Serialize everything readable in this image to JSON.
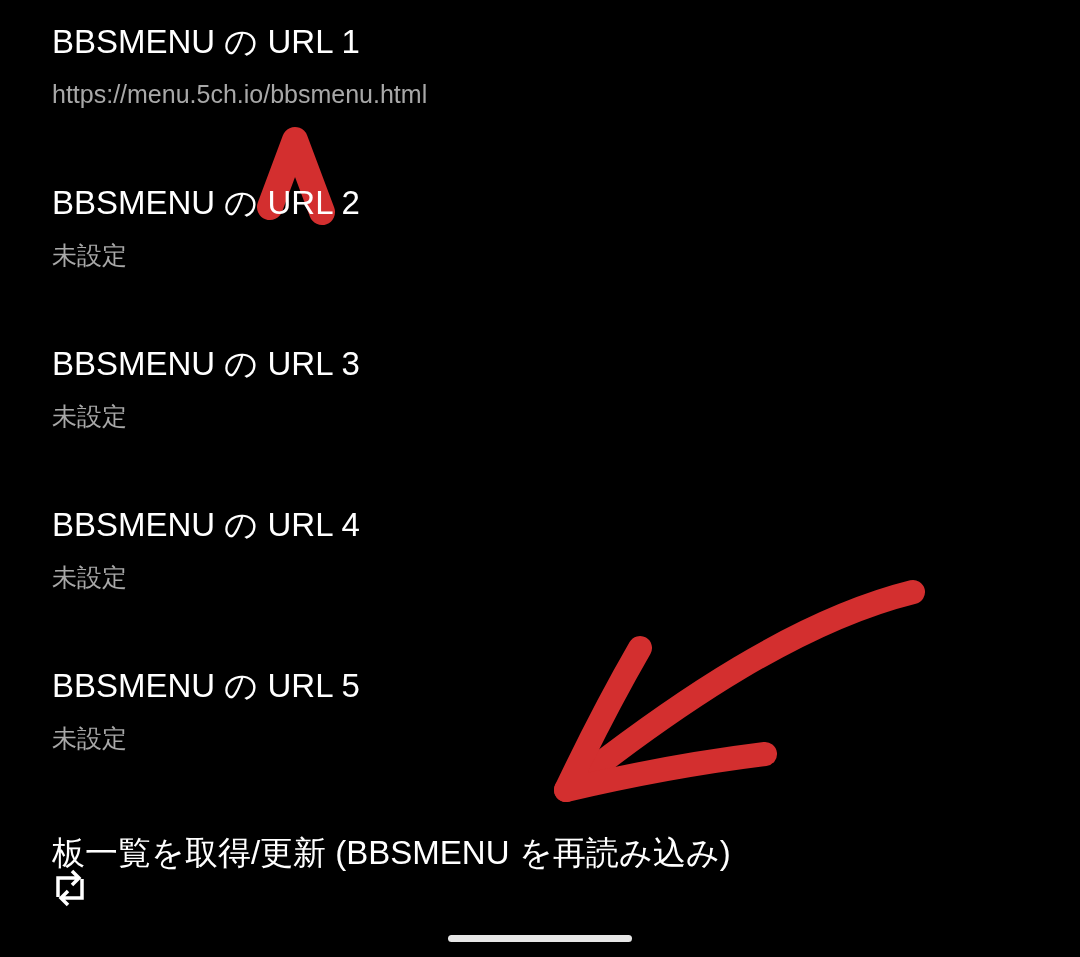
{
  "settings": [
    {
      "kind": "setting",
      "title": "BBSMENU の URL 1",
      "summary": "https://menu.5ch.io/bbsmenu.html"
    },
    {
      "kind": "setting",
      "title": "BBSMENU の URL 2",
      "summary": "未設定"
    },
    {
      "kind": "setting",
      "title": "BBSMENU の URL 3",
      "summary": "未設定"
    },
    {
      "kind": "setting",
      "title": "BBSMENU の URL 4",
      "summary": "未設定"
    },
    {
      "kind": "setting",
      "title": "BBSMENU の URL 5",
      "summary": "未設定"
    },
    {
      "kind": "action",
      "title": "板一覧を取得/更新 (BBSMENU を再読み込み)"
    }
  ]
}
